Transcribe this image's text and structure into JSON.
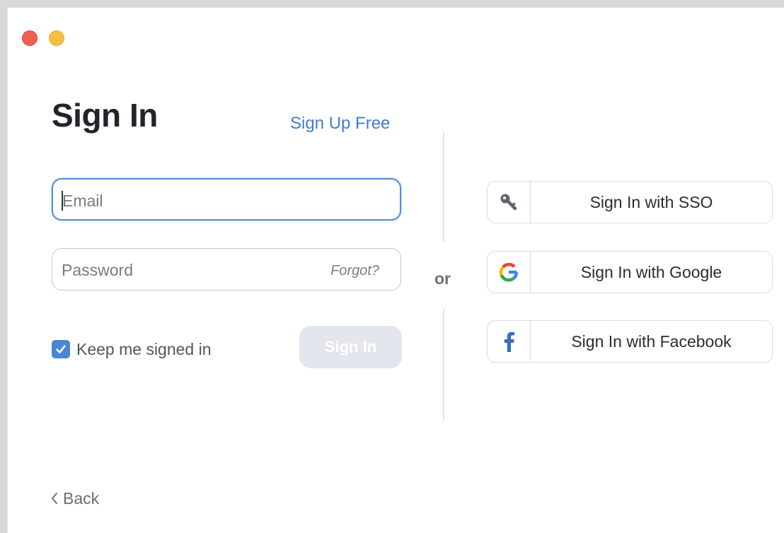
{
  "window": {
    "controls": [
      "close",
      "minimize"
    ]
  },
  "header": {
    "title": "Sign In",
    "signup_link": "Sign Up Free"
  },
  "form": {
    "email": {
      "value": "",
      "placeholder": "Email"
    },
    "password": {
      "value": "",
      "placeholder": "Password",
      "forgot_label": "Forgot?"
    },
    "keep_signed_in": {
      "label": "Keep me signed in",
      "checked": true
    },
    "submit_label": "Sign In"
  },
  "separator": {
    "label": "or"
  },
  "alt_signin": [
    {
      "label": "Sign In with SSO",
      "icon": "key-icon"
    },
    {
      "label": "Sign In with Google",
      "icon": "google-icon"
    },
    {
      "label": "Sign In with Facebook",
      "icon": "facebook-icon"
    }
  ],
  "footer": {
    "back_label": "Back"
  },
  "colors": {
    "accent": "#3d7fd1",
    "checkbox": "#4b86d6",
    "disabled_button": "#e4e6ee",
    "close": "#ee5f53",
    "minimize": "#f7bd42"
  }
}
